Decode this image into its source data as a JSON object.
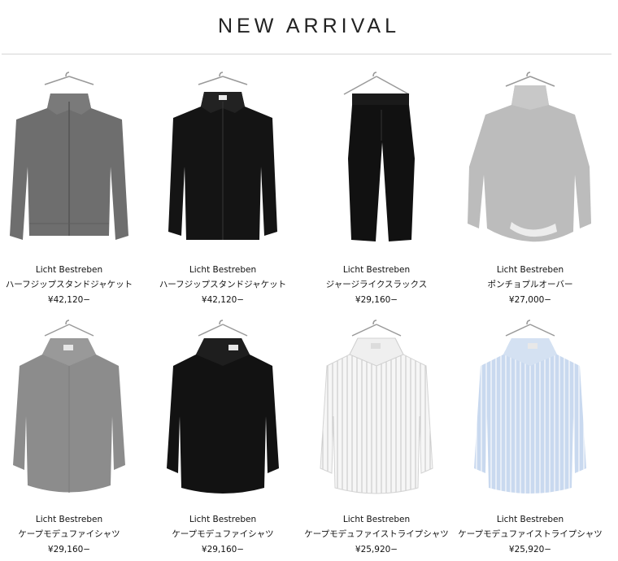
{
  "section_title": "NEW ARRIVAL",
  "products": [
    {
      "brand": "Licht Bestreben",
      "name": "ハーフジップスタンドジャケット",
      "price": "¥42,120−",
      "image": "grey-half-zip-jacket",
      "color": "#6e6e6e"
    },
    {
      "brand": "Licht Bestreben",
      "name": "ハーフジップスタンドジャケット",
      "price": "¥42,120−",
      "image": "black-half-zip-jacket",
      "color": "#141414"
    },
    {
      "brand": "Licht Bestreben",
      "name": "ジャージライクスラックス",
      "price": "¥29,160−",
      "image": "black-slacks",
      "color": "#111111"
    },
    {
      "brand": "Licht Bestreben",
      "name": "ポンチョプルオーバー",
      "price": "¥27,000−",
      "image": "grey-poncho-pullover",
      "color": "#b8b8b8"
    },
    {
      "brand": "Licht Bestreben",
      "name": "ケープモデュファイシャツ",
      "price": "¥29,160−",
      "image": "grey-cape-shirt",
      "color": "#8c8c8c"
    },
    {
      "brand": "Licht Bestreben",
      "name": "ケープモデュファイシャツ",
      "price": "¥29,160−",
      "image": "black-cape-shirt",
      "color": "#121212"
    },
    {
      "brand": "Licht Bestreben",
      "name": "ケープモデュファイストライプシャツ",
      "price": "¥25,920−",
      "image": "white-stripe-cape-shirt",
      "color": "#f3f3f3"
    },
    {
      "brand": "Licht Bestreben",
      "name": "ケープモデュファイストライプシャツ",
      "price": "¥25,920−",
      "image": "blue-stripe-cape-shirt",
      "color": "#bcd0ea"
    }
  ]
}
